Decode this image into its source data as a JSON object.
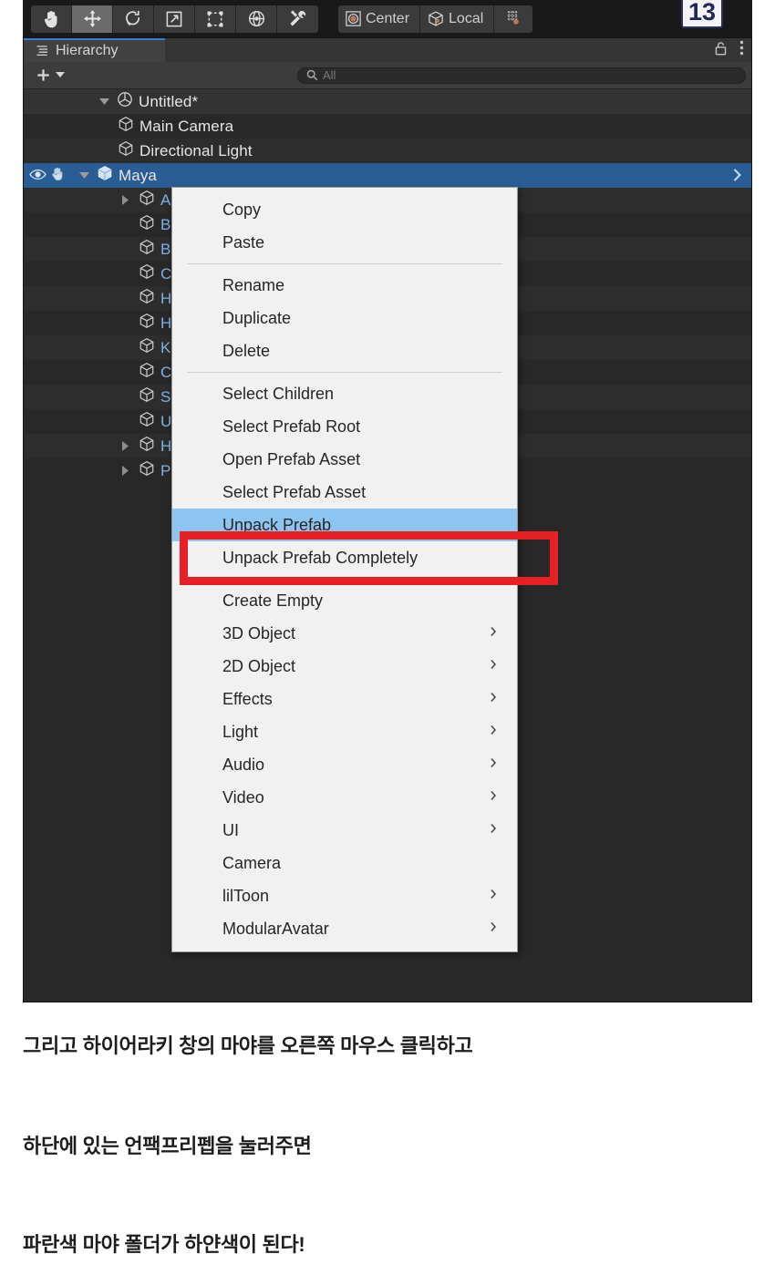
{
  "toolbar": {
    "tools": [
      {
        "name": "hand-tool",
        "icon": "hand",
        "active": false
      },
      {
        "name": "move-tool",
        "icon": "move",
        "active": true
      },
      {
        "name": "rotate-tool",
        "icon": "rotate",
        "active": false
      },
      {
        "name": "scale-tool",
        "icon": "scale",
        "active": false
      },
      {
        "name": "rect-tool",
        "icon": "rect",
        "active": false
      },
      {
        "name": "transform-tool",
        "icon": "transform",
        "active": false
      },
      {
        "name": "custom-tool",
        "icon": "wrench",
        "active": false
      }
    ],
    "pivot_label": "Center",
    "space_label": "Local",
    "snap_label": "",
    "badge": "13",
    "accent_blue": "#3d7dd6"
  },
  "panel": {
    "tab_label": "Hierarchy",
    "add_label": "+",
    "search_placeholder": "All",
    "lock_icon": "lock-icon",
    "menu_icon": "kebab-menu-icon"
  },
  "tree": {
    "scene": {
      "label": "Untitled*",
      "icon": "scene-icon",
      "expanded": true
    },
    "items": [
      {
        "label": "Main Camera",
        "indent": 2,
        "icon": "gameobject-icon",
        "expandable": false,
        "color": "white",
        "selected": false
      },
      {
        "label": "Directional Light",
        "indent": 2,
        "icon": "gameobject-icon",
        "expandable": false,
        "color": "white",
        "selected": false
      },
      {
        "label": "Maya",
        "indent": 1,
        "icon": "prefab-icon",
        "expandable": true,
        "color": "white",
        "selected": true
      },
      {
        "label": "A",
        "indent": 3,
        "icon": "gameobject-icon",
        "expandable": true,
        "color": "blue",
        "selected": false
      },
      {
        "label": "B",
        "indent": 3,
        "icon": "gameobject-icon",
        "expandable": false,
        "color": "blue",
        "selected": false
      },
      {
        "label": "B",
        "indent": 3,
        "icon": "gameobject-icon",
        "expandable": false,
        "color": "blue",
        "selected": false
      },
      {
        "label": "C",
        "indent": 3,
        "icon": "gameobject-icon",
        "expandable": false,
        "color": "blue",
        "selected": false
      },
      {
        "label": "H",
        "indent": 3,
        "icon": "gameobject-icon",
        "expandable": false,
        "color": "blue",
        "selected": false
      },
      {
        "label": "H",
        "indent": 3,
        "icon": "gameobject-icon",
        "expandable": false,
        "color": "blue",
        "selected": false
      },
      {
        "label": "K",
        "indent": 3,
        "icon": "gameobject-icon",
        "expandable": false,
        "color": "blue",
        "selected": false
      },
      {
        "label": "C",
        "indent": 3,
        "icon": "gameobject-icon",
        "expandable": false,
        "color": "blue",
        "selected": false
      },
      {
        "label": "S",
        "indent": 3,
        "icon": "gameobject-icon",
        "expandable": false,
        "color": "blue",
        "selected": false
      },
      {
        "label": "U",
        "indent": 3,
        "icon": "gameobject-icon",
        "expandable": false,
        "color": "blue",
        "selected": false
      },
      {
        "label": "H",
        "indent": 3,
        "icon": "gameobject-icon",
        "expandable": true,
        "color": "blue",
        "selected": false
      },
      {
        "label": "P",
        "indent": 3,
        "icon": "gameobject-icon",
        "expandable": true,
        "color": "blue",
        "selected": false
      }
    ]
  },
  "context_menu": {
    "items": [
      {
        "label": "Copy",
        "submenu": false,
        "highlight": false,
        "sep_after": false
      },
      {
        "label": "Paste",
        "submenu": false,
        "highlight": false,
        "sep_after": true
      },
      {
        "label": "Rename",
        "submenu": false,
        "highlight": false,
        "sep_after": false
      },
      {
        "label": "Duplicate",
        "submenu": false,
        "highlight": false,
        "sep_after": false
      },
      {
        "label": "Delete",
        "submenu": false,
        "highlight": false,
        "sep_after": true
      },
      {
        "label": "Select Children",
        "submenu": false,
        "highlight": false,
        "sep_after": false
      },
      {
        "label": "Select Prefab Root",
        "submenu": false,
        "highlight": false,
        "sep_after": false
      },
      {
        "label": "Open Prefab Asset",
        "submenu": false,
        "highlight": false,
        "sep_after": false
      },
      {
        "label": "Select Prefab Asset",
        "submenu": false,
        "highlight": false,
        "sep_after": false
      },
      {
        "label": "Unpack Prefab",
        "submenu": false,
        "highlight": true,
        "sep_after": false
      },
      {
        "label": "Unpack Prefab Completely",
        "submenu": false,
        "highlight": false,
        "sep_after": true
      },
      {
        "label": "Create Empty",
        "submenu": false,
        "highlight": false,
        "sep_after": false
      },
      {
        "label": "3D Object",
        "submenu": true,
        "highlight": false,
        "sep_after": false
      },
      {
        "label": "2D Object",
        "submenu": true,
        "highlight": false,
        "sep_after": false
      },
      {
        "label": "Effects",
        "submenu": true,
        "highlight": false,
        "sep_after": false
      },
      {
        "label": "Light",
        "submenu": true,
        "highlight": false,
        "sep_after": false
      },
      {
        "label": "Audio",
        "submenu": true,
        "highlight": false,
        "sep_after": false
      },
      {
        "label": "Video",
        "submenu": true,
        "highlight": false,
        "sep_after": false
      },
      {
        "label": "UI",
        "submenu": true,
        "highlight": false,
        "sep_after": false
      },
      {
        "label": "Camera",
        "submenu": false,
        "highlight": false,
        "sep_after": false
      },
      {
        "label": "lilToon",
        "submenu": true,
        "highlight": false,
        "sep_after": false
      },
      {
        "label": "ModularAvatar",
        "submenu": true,
        "highlight": false,
        "sep_after": false
      }
    ],
    "highlight_color": "#8ec5f0",
    "annotation_color": "#e81f24"
  },
  "captions": {
    "line1": "그리고 하이어라키 창의 마야를 오른쪽 마우스 클릭하고",
    "line2": "하단에 있는 언팩프리펩을 눌러주면",
    "line3": "파란색 마야 폴더가 하얀색이 된다!"
  }
}
